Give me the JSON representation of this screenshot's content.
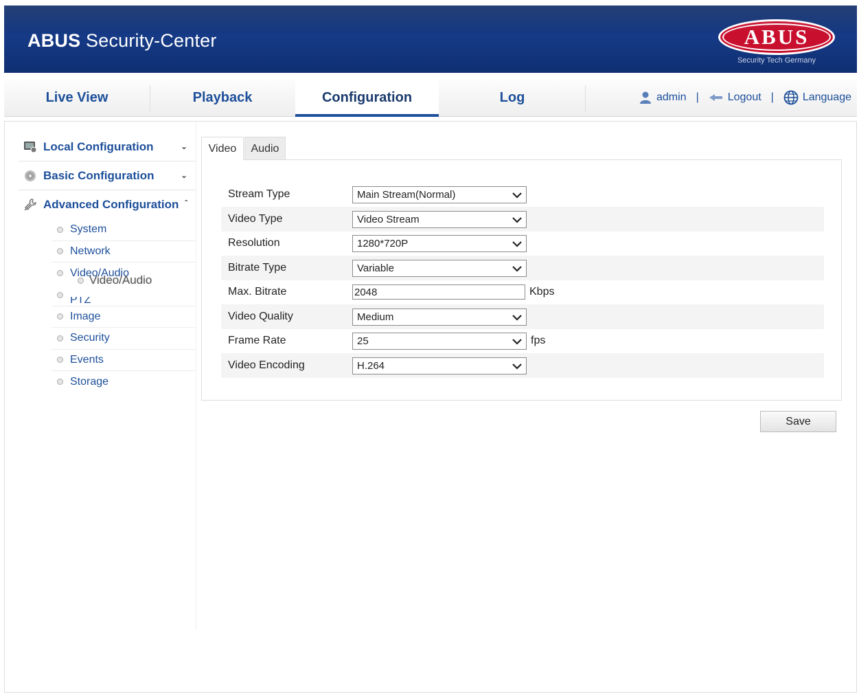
{
  "header": {
    "app_title_bold": "ABUS",
    "app_title_rest": " Security-Center",
    "logo_text": "ABUS",
    "logo_sub": "Security Tech Germany",
    "brand_color": "#c8102e",
    "banner_color": "#163a86"
  },
  "nav": {
    "tabs": [
      {
        "label": "Live View"
      },
      {
        "label": "Playback"
      },
      {
        "label": "Configuration"
      },
      {
        "label": "Log"
      }
    ],
    "active_tab": "Configuration",
    "user": "admin",
    "logout": "Logout",
    "language": "Language",
    "sep": "|"
  },
  "sidebar": {
    "sections": [
      {
        "label": "Local Configuration",
        "icon": "monitor-icon",
        "state": "collapsed"
      },
      {
        "label": "Basic Configuration",
        "icon": "gear-icon",
        "state": "collapsed"
      },
      {
        "label": "Advanced Configuration",
        "icon": "wrench-icon",
        "state": "expanded"
      }
    ],
    "items": [
      {
        "label": "System"
      },
      {
        "label": "Network"
      },
      {
        "label": "Video/Audio"
      },
      {
        "label": "PTZ"
      },
      {
        "label": "Image"
      },
      {
        "label": "Security"
      },
      {
        "label": "Events"
      },
      {
        "label": "Storage"
      }
    ],
    "drag_ghost": "Video/Audio"
  },
  "subtabs": {
    "video": "Video",
    "audio": "Audio",
    "active": "Video"
  },
  "form": {
    "stream_type": {
      "label": "Stream Type",
      "value": "Main Stream(Normal)"
    },
    "video_type": {
      "label": "Video Type",
      "value": "Video Stream"
    },
    "resolution": {
      "label": "Resolution",
      "value": "1280*720P"
    },
    "bitrate_type": {
      "label": "Bitrate Type",
      "value": "Variable"
    },
    "max_bitrate": {
      "label": "Max. Bitrate",
      "value": "2048",
      "unit": "Kbps"
    },
    "video_quality": {
      "label": "Video Quality",
      "value": "Medium"
    },
    "frame_rate": {
      "label": "Frame Rate",
      "value": "25",
      "unit": "fps"
    },
    "video_encoding": {
      "label": "Video Encoding",
      "value": "H.264"
    }
  },
  "save_label": "Save"
}
